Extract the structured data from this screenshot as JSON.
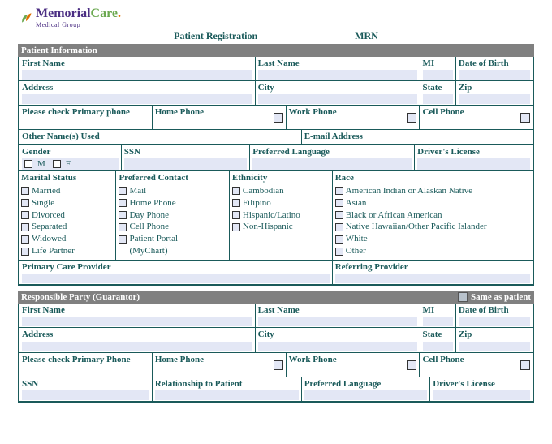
{
  "logo": {
    "brand_left": "Memorial",
    "brand_right": "Care",
    "dot": ".",
    "sub": "Medical Group"
  },
  "header": {
    "title": "Patient Registration",
    "mrn": "MRN"
  },
  "sections": {
    "patient_info": "Patient Information",
    "guarantor": "Responsible Party (Guarantor)",
    "same_as": "Same as patient"
  },
  "labels": {
    "first_name": "First Name",
    "last_name": "Last Name",
    "mi": "MI",
    "dob": "Date of Birth",
    "address": "Address",
    "city": "City",
    "state": "State",
    "zip": "Zip",
    "primary_phone_q": "Please check Primary phone",
    "primary_phone_q2": "Please check Primary Phone",
    "home_phone": "Home Phone",
    "work_phone": "Work Phone",
    "cell_phone": "Cell Phone",
    "other_names": "Other Name(s) Used",
    "email": "E-mail Address",
    "gender": "Gender",
    "m": "M",
    "f": "F",
    "ssn": "SSN",
    "pref_lang": "Preferred Language",
    "dl": "Driver's License",
    "marital": "Marital Status",
    "pref_contact": "Preferred Contact",
    "ethnicity": "Ethnicity",
    "race": "Race",
    "pcp": "Primary Care Provider",
    "ref_prov": "Referring Provider",
    "rel_to_patient": "Relationship to Patient"
  },
  "marital_opts": [
    "Married",
    "Single",
    "Divorced",
    "Separated",
    "Widowed",
    "Life Partner"
  ],
  "contact_opts": [
    "Mail",
    "Home Phone",
    "Day Phone",
    "Cell Phone",
    "Patient Portal",
    "(MyChart)"
  ],
  "ethnicity_opts": [
    "Cambodian",
    "Filipino",
    "Hispanic/Latino",
    "Non-Hispanic"
  ],
  "race_opts": [
    "American Indian or Alaskan Native",
    "Asian",
    "Black or African American",
    "Native Hawaiian/Other Pacific Islander",
    "White",
    "Other"
  ]
}
